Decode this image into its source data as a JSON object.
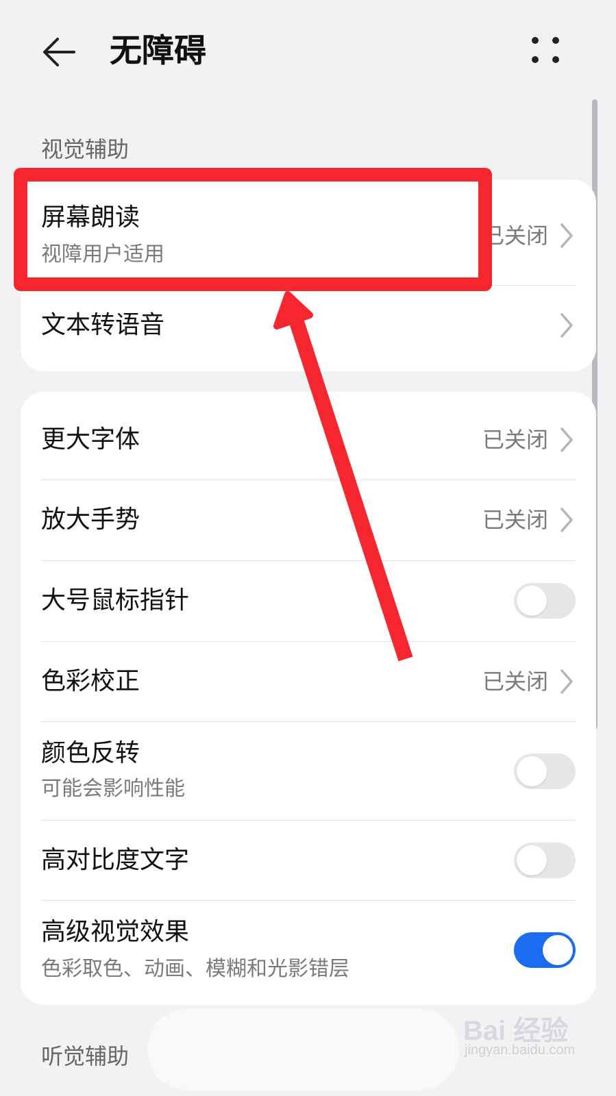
{
  "header": {
    "title": "无障碍",
    "back_icon": "arrow-left-icon",
    "more_icon": "more-grid-icon"
  },
  "sections": {
    "visual": "视觉辅助",
    "hearing": "听觉辅助"
  },
  "card1": {
    "screen_reader": {
      "title": "屏幕朗读",
      "subtitle": "视障用户适用",
      "value": "已关闭"
    },
    "tts": {
      "title": "文本转语音"
    }
  },
  "card2": {
    "larger_font": {
      "title": "更大字体",
      "value": "已关闭"
    },
    "magnify": {
      "title": "放大手势",
      "value": "已关闭"
    },
    "large_pointer": {
      "title": "大号鼠标指针",
      "toggle": false
    },
    "color_correction": {
      "title": "色彩校正",
      "value": "已关闭"
    },
    "color_inversion": {
      "title": "颜色反转",
      "subtitle": "可能会影响性能",
      "toggle": false
    },
    "high_contrast": {
      "title": "高对比度文字",
      "toggle": false
    },
    "advanced_visual": {
      "title": "高级视觉效果",
      "subtitle": "色彩取色、动画、模糊和光影错层",
      "toggle": true
    }
  },
  "watermark": {
    "brand": "Bai 经验",
    "url": "jingyan.baidu.com"
  },
  "colors": {
    "background": "#f1f2f4",
    "card": "#ffffff",
    "accent_toggle": "#1a6cf3",
    "annotation_red": "#f5262e"
  }
}
